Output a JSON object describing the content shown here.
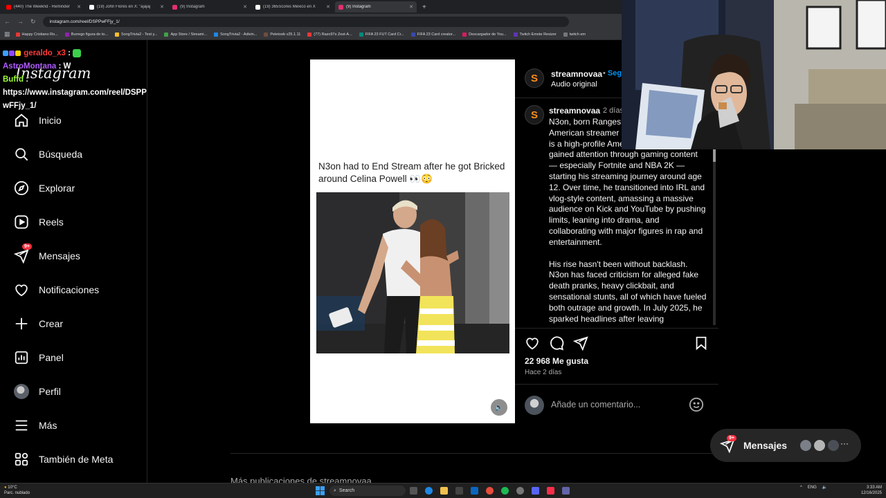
{
  "browser": {
    "tabs": [
      {
        "title": "(440) The Weeknd - Reminder",
        "color": "#ff0000"
      },
      {
        "title": "(19) John Flores en X: \"ajajaj",
        "color": "#ffffff"
      },
      {
        "title": "(9) Instagram",
        "color": "#e1306c"
      },
      {
        "title": "(19) 365Scores México en X",
        "color": "#ffffff"
      },
      {
        "title": "(9) Instagram",
        "color": "#e1306c",
        "active": true
      }
    ],
    "url": "instagram.com/reel/DSPPwFFjy_1/",
    "bookmarks": [
      "Happy Cristiano Ro...",
      "Burrego figura de to...",
      "SongTrivia2 - Test y...",
      "App Store / Streami...",
      "SongTrivia2 - Adivin...",
      "Peletoob v25.1.11",
      "(77) Razo97s Zest-A...",
      "FIFA 23 FUT Card Cr...",
      "FIFA 23 Card creator...",
      "Descargador de You...",
      "Twitch Emote Resizer",
      "twitch em"
    ]
  },
  "chat": {
    "messages": [
      {
        "user": "geraldo_x3",
        "user_color": "#ff3a3a",
        "text": ":"
      },
      {
        "user": "AstroMontana",
        "user_color": "#b05cff",
        "text": ": W"
      },
      {
        "user": "Buffd",
        "user_color": "#9dff3a",
        "text": ":"
      },
      {
        "text": "https://www.instagram.com/reel/DSPPwFFjy_1/"
      }
    ]
  },
  "sidebar": {
    "logo": "Instagram",
    "items": [
      {
        "label": "Inicio",
        "icon": "home-icon"
      },
      {
        "label": "Búsqueda",
        "icon": "search-icon"
      },
      {
        "label": "Explorar",
        "icon": "compass-icon"
      },
      {
        "label": "Reels",
        "icon": "reels-icon"
      },
      {
        "label": "Mensajes",
        "icon": "messages-icon",
        "badge": "9+"
      },
      {
        "label": "Notificaciones",
        "icon": "heart-icon"
      },
      {
        "label": "Crear",
        "icon": "plus-icon"
      },
      {
        "label": "Panel",
        "icon": "chart-icon"
      },
      {
        "label": "Perfil",
        "icon": "avatar"
      },
      {
        "label": "Más",
        "icon": "menu-icon"
      },
      {
        "label": "También de Meta",
        "icon": "meta-icon"
      }
    ]
  },
  "post": {
    "media_caption": "N3on had to End Stream after he got Bricked around Celina Powell 👀😳",
    "username": "streamnovaa",
    "follow": "Seguir",
    "audio": "Audio original",
    "avatar_letter": "S",
    "comment_user": "streamnovaa",
    "comment_time": "2 días",
    "caption_paragraphs": [
      "N3on, born Rangesh, is a high-profile American streamer born August 13, 2004, is a high-profile American streamer. He first gained attention through gaming content — especially Fortnite and NBA 2K — starting his streaming journey around age 12. Over time, he transitioned into IRL and vlog-style content, amassing a massive audience on Kick and YouTube by pushing limits, leaning into drama, and collaborating with major figures in rap and entertainment.",
      "His rise hasn't been without backlash. N3on has faced criticism for alleged fake death pranks, heavy clickbait, and sensational stunts, all of which have fueled both outrage and growth. In July 2025, he sparked headlines after leaving"
    ],
    "likes": "22 968 Me gusta",
    "ago": "Hace 2 días",
    "comment_placeholder": "Añade un comentario...",
    "more_from": "Más publicaciones de streamnovaa"
  },
  "messages_pill": {
    "label": "Mensajes",
    "badge": "9+"
  },
  "taskbar": {
    "weather_temp": "10°C",
    "weather_desc": "Parc. nublado",
    "search": "Search",
    "lang": "ENG",
    "time": "3:33 AM",
    "date": "12/16/2025"
  },
  "colors": {
    "accent_blue": "#0095f6",
    "badge_red": "#ff3040"
  }
}
